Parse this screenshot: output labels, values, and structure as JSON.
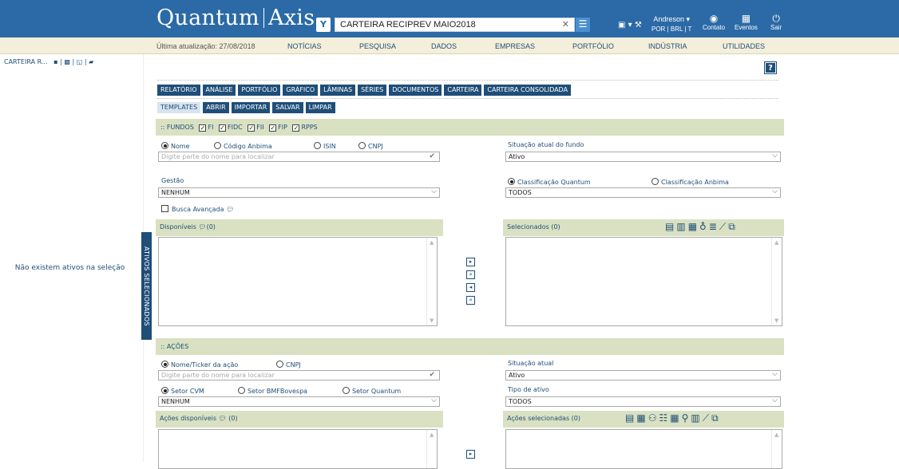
{
  "header": {
    "logo_left": "Quantum",
    "logo_right": "Axis",
    "search_value": "CARTEIRA RECIPREV MAIO2018",
    "user_name": "Andreson ▾",
    "user_sub": "POR | BRL | T",
    "contato": "Contato",
    "eventos": "Eventos",
    "sair": "Sair"
  },
  "subnav": {
    "updated": "Última atualização: 27/08/2018",
    "items": [
      "NOTÍCIAS",
      "PESQUISA",
      "DADOS",
      "EMPRESAS",
      "PORTFÓLIO",
      "INDÚSTRIA",
      "UTILIDADES"
    ]
  },
  "left": {
    "title": "CARTEIRA R...",
    "empty_msg": "Não existem ativos na seleção",
    "vertical_tab": "ATIVOS SELECIONADOS"
  },
  "tabs": [
    "RELATÓRIO",
    "ANÁLISE",
    "PORTFÓLIO",
    "GRÁFICO",
    "LÂMINAS",
    "SÉRIES",
    "DOCUMENTOS",
    "CARTEIRA",
    "CARTEIRA CONSOLIDADA"
  ],
  "subtabs": [
    "TEMPLATES",
    "ABRIR",
    "IMPORTAR",
    "SALVAR",
    "LIMPAR"
  ],
  "fundos": {
    "title": ":: FUNDOS",
    "types": [
      "FI",
      "FIDC",
      "FII",
      "FIP",
      "RPPS"
    ],
    "radios": [
      "Nome",
      "Código Anbima",
      "ISIN",
      "CNPJ"
    ],
    "search_placeholder": "Digite parte do nome para localizar",
    "situacao_label": "Situação atual do fundo",
    "situacao_value": "Ativo",
    "gestao_label": "Gestão",
    "gestao_value": "NENHUM",
    "class_quantum": "Classificação Quantum",
    "class_anbima": "Classificação Anbima",
    "class_value": "TODOS",
    "busca": "Busca Avançada",
    "disponiveis": "Disponíveis",
    "disponiveis_count": "(0)",
    "selecionados": "Selecionados (0)"
  },
  "acoes": {
    "title": ":: AÇÕES",
    "radio_nome": "Nome/Ticker da ação",
    "radio_cnpj": "CNPJ",
    "search_placeholder": "Digite parte do nome para localizar",
    "situacao_label": "Situação atual",
    "situacao_value": "Ativo",
    "setor_cvm": "Setor CVM",
    "setor_bmf": "Setor BMFBovespa",
    "setor_quantum": "Setor Quantum",
    "setor_value": "NENHUM",
    "tipo_label": "Tipo de ativo",
    "tipo_value": "TODOS",
    "disponiveis": "Ações disponíveis",
    "disponiveis_count": "(0)",
    "selecionadas": "Ações selecionadas (0)"
  }
}
